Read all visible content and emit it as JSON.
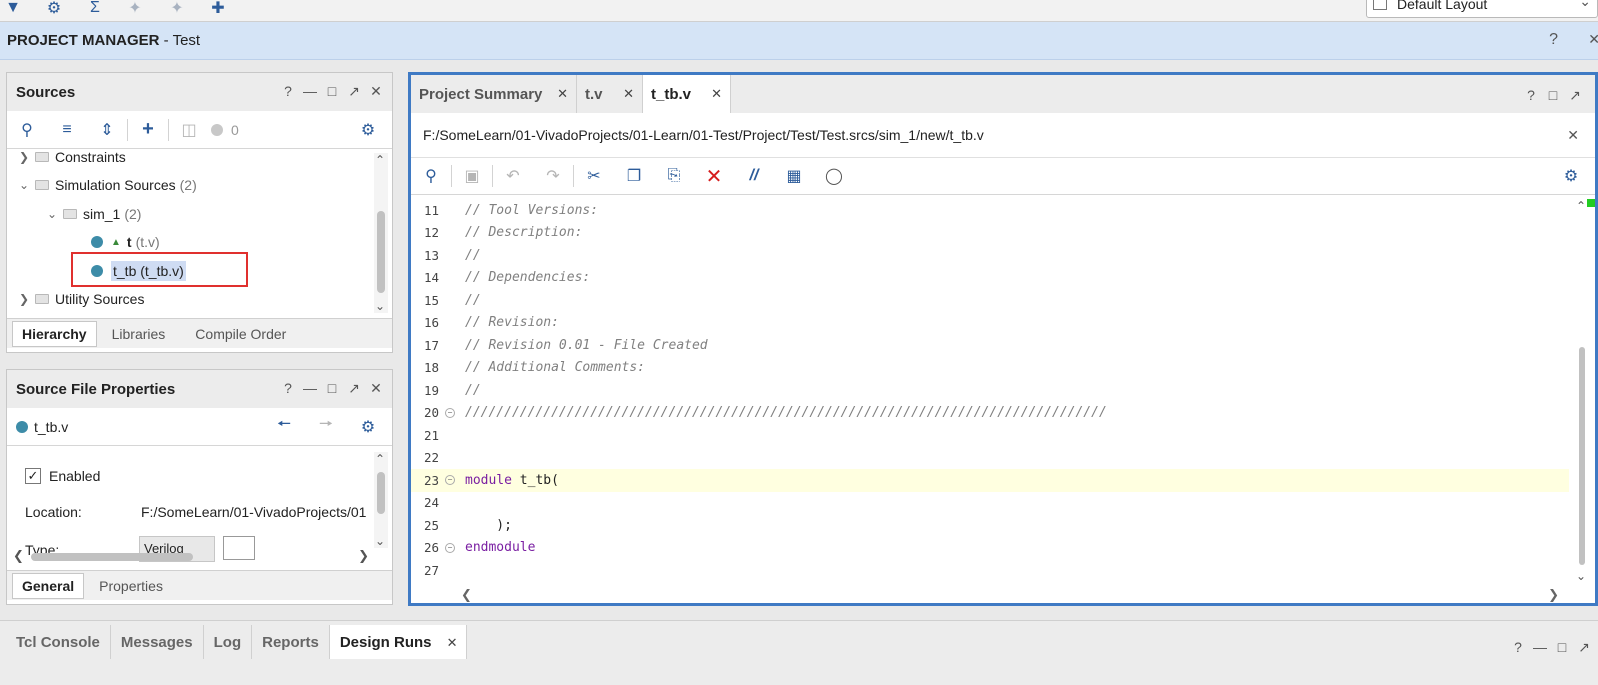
{
  "toolbar": {
    "icons": [
      "run-icon",
      "gear-icon",
      "sigma-icon",
      "wand-icon",
      "wand-disabled-icon",
      "probe-icon"
    ],
    "layout_select": "Default Layout"
  },
  "pm_bar": {
    "title_bold": "PROJECT MANAGER",
    "title_rest": " - Test",
    "help": "?"
  },
  "sources": {
    "title": "Sources",
    "count": "0",
    "tree": [
      {
        "label": "Constraints",
        "count": "",
        "indent": 0,
        "kind": "folder",
        "expanded": false
      },
      {
        "label": "Simulation Sources",
        "count": "(2)",
        "indent": 0,
        "kind": "folder",
        "expanded": true
      },
      {
        "label": "sim_1",
        "count": "(2)",
        "indent": 1,
        "kind": "folder",
        "expanded": true
      },
      {
        "label": "t",
        "sub": "(t.v)",
        "indent": 2,
        "kind": "file"
      },
      {
        "label": "t_tb (t_tb.v)",
        "indent": 2,
        "kind": "file-selected"
      },
      {
        "label": "Utility Sources",
        "count": "",
        "indent": 0,
        "kind": "folder",
        "expanded": false
      }
    ],
    "tabs": [
      "Hierarchy",
      "Libraries",
      "Compile Order"
    ]
  },
  "props": {
    "title": "Source File Properties",
    "file": "t_tb.v",
    "enabled_label": "Enabled",
    "location_label": "Location:",
    "location_value": "F:/SomeLearn/01-VivadoProjects/01",
    "type_label": "Type:",
    "type_value": "Verilog",
    "tabs": [
      "General",
      "Properties"
    ]
  },
  "editor": {
    "tabs": [
      {
        "label": "Project Summary",
        "active": false
      },
      {
        "label": "t.v",
        "active": false
      },
      {
        "label": "t_tb.v",
        "active": true
      }
    ],
    "path": "F:/SomeLearn/01-VivadoProjects/01-Learn/01-Test/Project/Test/Test.srcs/sim_1/new/t_tb.v",
    "lines": [
      {
        "n": "11",
        "text": "// Tool Versions:",
        "type": "cmt"
      },
      {
        "n": "12",
        "text": "// Description:",
        "type": "cmt"
      },
      {
        "n": "13",
        "text": "//",
        "type": "cmt"
      },
      {
        "n": "14",
        "text": "// Dependencies:",
        "type": "cmt"
      },
      {
        "n": "15",
        "text": "//",
        "type": "cmt"
      },
      {
        "n": "16",
        "text": "// Revision:",
        "type": "cmt"
      },
      {
        "n": "17",
        "text": "// Revision 0.01 - File Created",
        "type": "cmt"
      },
      {
        "n": "18",
        "text": "// Additional Comments:",
        "type": "cmt"
      },
      {
        "n": "19",
        "text": "//",
        "type": "cmt"
      },
      {
        "n": "20",
        "text": "//////////////////////////////////////////////////////////////////////////////////",
        "type": "cmt",
        "fold": true
      },
      {
        "n": "21",
        "text": "",
        "type": "plain"
      },
      {
        "n": "22",
        "text": "",
        "type": "plain"
      },
      {
        "n": "23",
        "kw": "module",
        "rest": " t_tb(",
        "type": "kw",
        "fold": true,
        "current": true
      },
      {
        "n": "24",
        "text": "",
        "type": "plain"
      },
      {
        "n": "25",
        "text": "    );",
        "type": "plain"
      },
      {
        "n": "26",
        "kw": "endmodule",
        "rest": "",
        "type": "kw",
        "fold": true
      },
      {
        "n": "27",
        "text": "",
        "type": "plain"
      }
    ]
  },
  "bottom": {
    "tabs": [
      {
        "label": "Tcl Console",
        "active": false
      },
      {
        "label": "Messages",
        "active": false
      },
      {
        "label": "Log",
        "active": false
      },
      {
        "label": "Reports",
        "active": false
      },
      {
        "label": "Design Runs",
        "active": true
      }
    ]
  }
}
